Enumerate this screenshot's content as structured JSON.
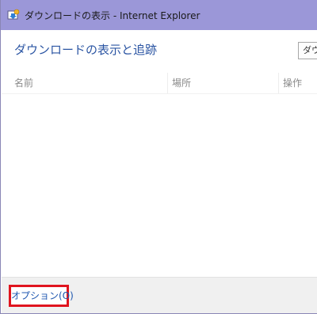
{
  "window": {
    "title": "ダウンロードの表示 - Internet Explorer",
    "icon": "ie-window-icon"
  },
  "main": {
    "heading": "ダウンロードの表示と追跡",
    "top_button_label": "ダウ"
  },
  "table": {
    "columns": [
      "名前",
      "場所",
      "操作"
    ],
    "rows": []
  },
  "footer": {
    "options_label": "オプション(O)",
    "highlight_color": "#e0141e"
  },
  "colors": {
    "titlebar": "#9b97d8",
    "heading": "#2b55a3",
    "link": "#1f57b0"
  }
}
